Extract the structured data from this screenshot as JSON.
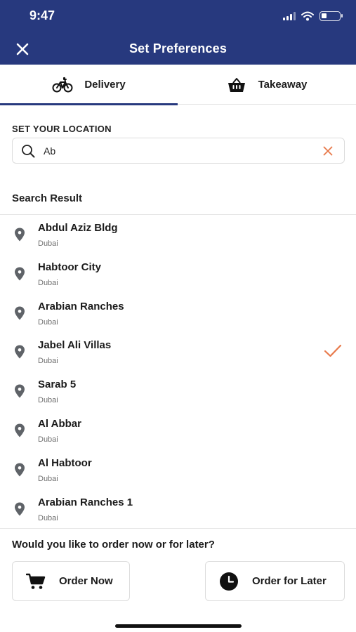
{
  "status_bar": {
    "time": "9:47"
  },
  "header": {
    "title": "Set Preferences",
    "close_icon": "close-icon"
  },
  "tabs": [
    {
      "label": "Delivery",
      "icon": "bicycle-icon",
      "active": true
    },
    {
      "label": "Takeaway",
      "icon": "basket-icon",
      "active": false
    }
  ],
  "location": {
    "section_label": "SET YOUR LOCATION",
    "search_value": "Ab",
    "search_icon": "search-icon",
    "clear_icon": "clear-icon"
  },
  "results": {
    "title": "Search Result",
    "items": [
      {
        "name": "Abdul Aziz Bldg",
        "city": "Dubai",
        "selected": false
      },
      {
        "name": "Habtoor City",
        "city": "Dubai",
        "selected": false
      },
      {
        "name": "Arabian Ranches",
        "city": "Dubai",
        "selected": false
      },
      {
        "name": "Jabel Ali Villas",
        "city": "Dubai",
        "selected": true
      },
      {
        "name": "Sarab 5",
        "city": "Dubai",
        "selected": false
      },
      {
        "name": "Al Abbar",
        "city": "Dubai",
        "selected": false
      },
      {
        "name": "Al Habtoor",
        "city": "Dubai",
        "selected": false
      },
      {
        "name": "Arabian Ranches 1",
        "city": "Dubai",
        "selected": false
      }
    ]
  },
  "order": {
    "question": "Would you like to order now or for later?",
    "now_label": "Order Now",
    "later_label": "Order for Later"
  },
  "colors": {
    "header_bg": "#27397e",
    "accent_orange": "#e8794a",
    "pin_gray": "#5f6368"
  }
}
